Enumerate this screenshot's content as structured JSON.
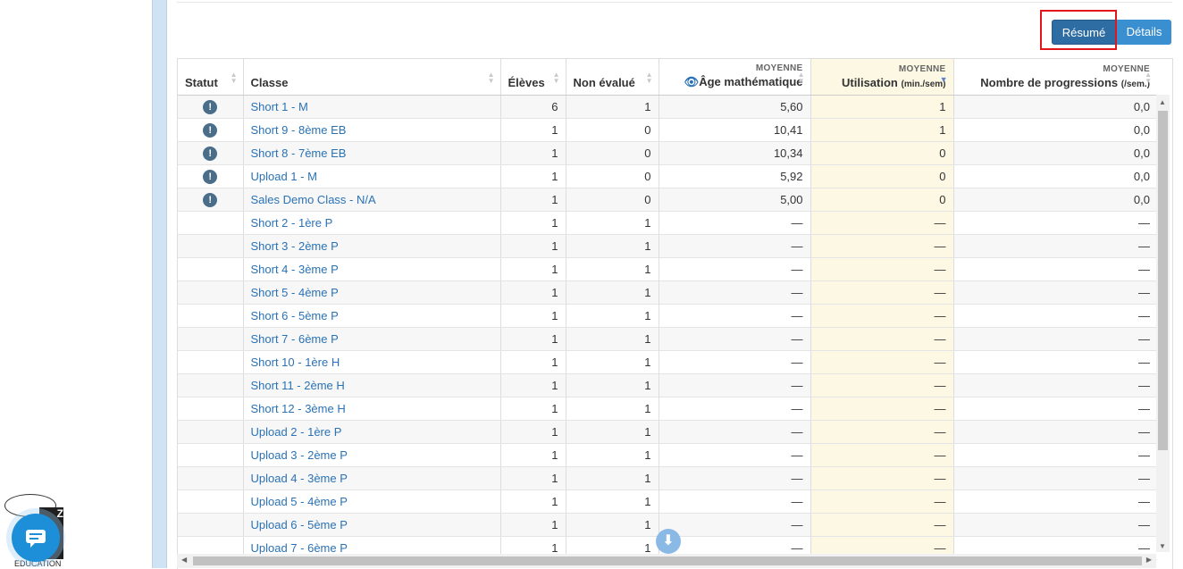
{
  "toolbar": {
    "resume_label": "Résumé",
    "details_label": "Détails"
  },
  "table": {
    "headers": {
      "statut": "Statut",
      "classe": "Classe",
      "eleves": "Élèves",
      "non_evalue": "Non évalué",
      "age_super": "MOYENNE",
      "age": "Âge mathématique",
      "util_super": "MOYENNE",
      "util": "Utilisation",
      "util_unit": "(min./sem)",
      "prog_super": "MOYENNE",
      "prog": "Nombre de progressions",
      "prog_unit": "(/sem.)"
    },
    "rows": [
      {
        "status": "!",
        "classe": "Short 1 - M",
        "eleves": "6",
        "non_evalue": "1",
        "age": "5,60",
        "util": "1",
        "prog": "0,0"
      },
      {
        "status": "!",
        "classe": "Short 9 - 8ème EB",
        "eleves": "1",
        "non_evalue": "0",
        "age": "10,41",
        "util": "1",
        "prog": "0,0"
      },
      {
        "status": "!",
        "classe": "Short 8 - 7ème EB",
        "eleves": "1",
        "non_evalue": "0",
        "age": "10,34",
        "util": "0",
        "prog": "0,0"
      },
      {
        "status": "!",
        "classe": "Upload 1 - M",
        "eleves": "1",
        "non_evalue": "0",
        "age": "5,92",
        "util": "0",
        "prog": "0,0"
      },
      {
        "status": "!",
        "classe": "Sales Demo Class - N/A",
        "eleves": "1",
        "non_evalue": "0",
        "age": "5,00",
        "util": "0",
        "prog": "0,0"
      },
      {
        "status": "",
        "classe": "Short 2 - 1ère P",
        "eleves": "1",
        "non_evalue": "1",
        "age": "—",
        "util": "—",
        "prog": "—"
      },
      {
        "status": "",
        "classe": "Short 3 - 2ème P",
        "eleves": "1",
        "non_evalue": "1",
        "age": "—",
        "util": "—",
        "prog": "—"
      },
      {
        "status": "",
        "classe": "Short 4 - 3ème P",
        "eleves": "1",
        "non_evalue": "1",
        "age": "—",
        "util": "—",
        "prog": "—"
      },
      {
        "status": "",
        "classe": "Short 5 - 4ème P",
        "eleves": "1",
        "non_evalue": "1",
        "age": "—",
        "util": "—",
        "prog": "—"
      },
      {
        "status": "",
        "classe": "Short 6 - 5ème P",
        "eleves": "1",
        "non_evalue": "1",
        "age": "—",
        "util": "—",
        "prog": "—"
      },
      {
        "status": "",
        "classe": "Short 7 - 6ème P",
        "eleves": "1",
        "non_evalue": "1",
        "age": "—",
        "util": "—",
        "prog": "—"
      },
      {
        "status": "",
        "classe": "Short 10 - 1ère H",
        "eleves": "1",
        "non_evalue": "1",
        "age": "—",
        "util": "—",
        "prog": "—"
      },
      {
        "status": "",
        "classe": "Short 11 - 2ème H",
        "eleves": "1",
        "non_evalue": "1",
        "age": "—",
        "util": "—",
        "prog": "—"
      },
      {
        "status": "",
        "classe": "Short 12 - 3ème H",
        "eleves": "1",
        "non_evalue": "1",
        "age": "—",
        "util": "—",
        "prog": "—"
      },
      {
        "status": "",
        "classe": "Upload 2 - 1ère P",
        "eleves": "1",
        "non_evalue": "1",
        "age": "—",
        "util": "—",
        "prog": "—"
      },
      {
        "status": "",
        "classe": "Upload 3 - 2ème P",
        "eleves": "1",
        "non_evalue": "1",
        "age": "—",
        "util": "—",
        "prog": "—"
      },
      {
        "status": "",
        "classe": "Upload 4 - 3ème P",
        "eleves": "1",
        "non_evalue": "1",
        "age": "—",
        "util": "—",
        "prog": "—"
      },
      {
        "status": "",
        "classe": "Upload 5 - 4ème P",
        "eleves": "1",
        "non_evalue": "1",
        "age": "—",
        "util": "—",
        "prog": "—"
      },
      {
        "status": "",
        "classe": "Upload 6 - 5ème P",
        "eleves": "1",
        "non_evalue": "1",
        "age": "—",
        "util": "—",
        "prog": "—"
      },
      {
        "status": "",
        "classe": "Upload 7 - 6ème P",
        "eleves": "1",
        "non_evalue": "1",
        "age": "—",
        "util": "—",
        "prog": "—"
      }
    ]
  },
  "widgets": {
    "logo_text": "EDUCATION",
    "logo_letters": "Z"
  },
  "colors": {
    "accent": "#2e6da4",
    "link": "#2a72b5",
    "highlight_column": "#fcf8e3",
    "annotation_box": "#e0161b",
    "chat_button": "#1d8fd8"
  },
  "icons": {
    "status": "warning-circle-icon",
    "age": "eye-icon",
    "scroll": "arrow-down-icon",
    "chat": "chat-icon"
  }
}
